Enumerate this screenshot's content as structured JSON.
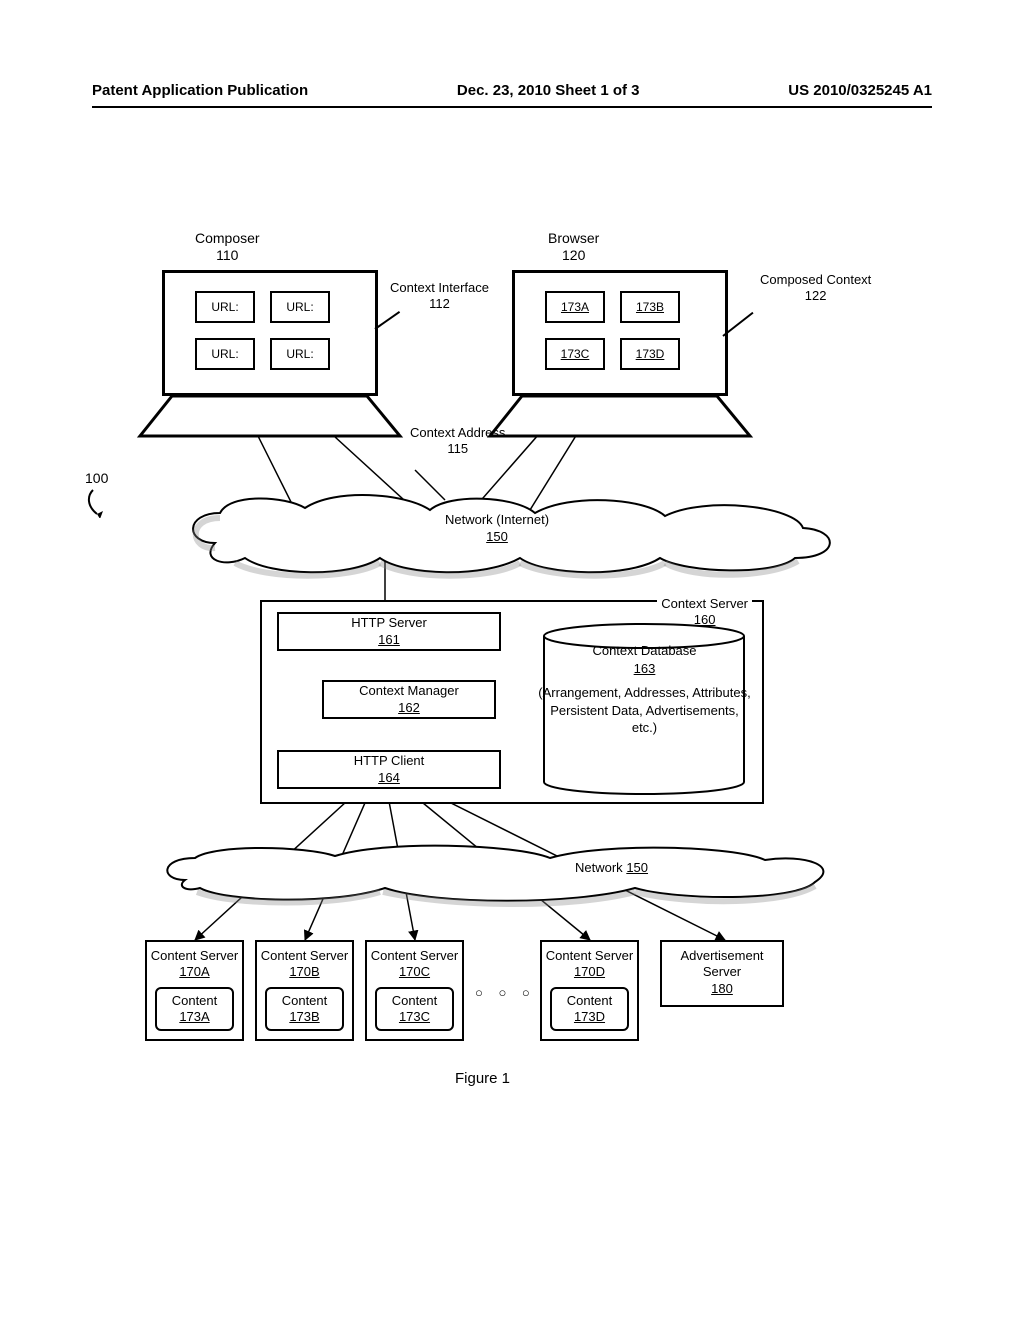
{
  "header": {
    "left": "Patent Application Publication",
    "center": "Dec. 23, 2010  Sheet 1 of 3",
    "right": "US 2010/0325245 A1"
  },
  "figure_caption": "Figure 1",
  "ref100": "100",
  "composer": {
    "title": "Composer",
    "num": "110",
    "cells": [
      "URL:",
      "URL:",
      "URL:",
      "URL:"
    ],
    "side_label": "Context Interface",
    "side_num": "112"
  },
  "browser": {
    "title": "Browser",
    "num": "120",
    "cells": [
      "173A",
      "173B",
      "173C",
      "173D"
    ],
    "side_label": "Composed Context",
    "side_num": "122"
  },
  "context_address": {
    "label": "Context Address",
    "num": "115"
  },
  "cloud1": {
    "label": "Network (Internet)",
    "num": "150"
  },
  "cloud2": {
    "label": "Network",
    "num": "150"
  },
  "context_server": {
    "label": "Context Server",
    "num": "160"
  },
  "http_server": {
    "label": "HTTP Server",
    "num": "161"
  },
  "context_manager": {
    "label": "Context Manager",
    "num": "162"
  },
  "http_client": {
    "label": "HTTP Client",
    "num": "164"
  },
  "db": {
    "title": "Context Database",
    "num": "163",
    "body": "(Arrangement, Addresses, Attributes, Persistent Data, Advertisements, etc.)"
  },
  "servers": {
    "label": "Content Server",
    "content_label": "Content",
    "items": [
      {
        "srv_num": "170A",
        "cnt_num": "173A"
      },
      {
        "srv_num": "170B",
        "cnt_num": "173B"
      },
      {
        "srv_num": "170C",
        "cnt_num": "173C"
      },
      {
        "srv_num": "170D",
        "cnt_num": "173D"
      }
    ]
  },
  "ad_server": {
    "label": "Advertisement Server",
    "num": "180"
  },
  "ellipsis": "○ ○ ○"
}
